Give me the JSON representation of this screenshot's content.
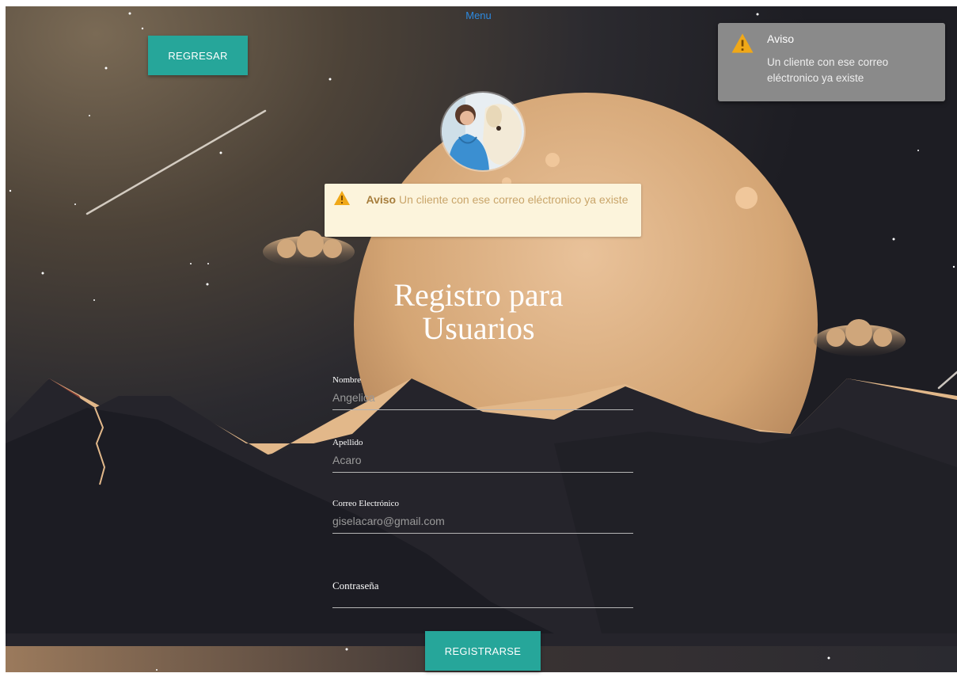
{
  "nav": {
    "menu_label": "Menu",
    "back_label": "REGRESAR"
  },
  "alert_inline": {
    "icon": "warning-icon",
    "title": "Aviso",
    "message": "Un cliente con ese correo eléctronico ya existe"
  },
  "toast": {
    "icon": "warning-icon",
    "title": "Aviso",
    "message": "Un cliente con ese correo eléctronico ya existe"
  },
  "form": {
    "title_line1": "Registro para",
    "title_line2": "Usuarios",
    "fields": [
      {
        "label": "Nombre",
        "value": "Angelica"
      },
      {
        "label": "Apellido",
        "value": "Acaro"
      },
      {
        "label": "Correo Electrónico",
        "value": "giselacaro@gmail.com"
      },
      {
        "label": "Contraseña",
        "value": ""
      }
    ],
    "submit_label": "REGISTRARSE"
  },
  "colors": {
    "button": "#26a69a",
    "menu_link": "#2d8ae0",
    "alert_bg": "#fcf4dc",
    "toast_bg": "#8a8a8a",
    "moon": "#d6a875"
  }
}
